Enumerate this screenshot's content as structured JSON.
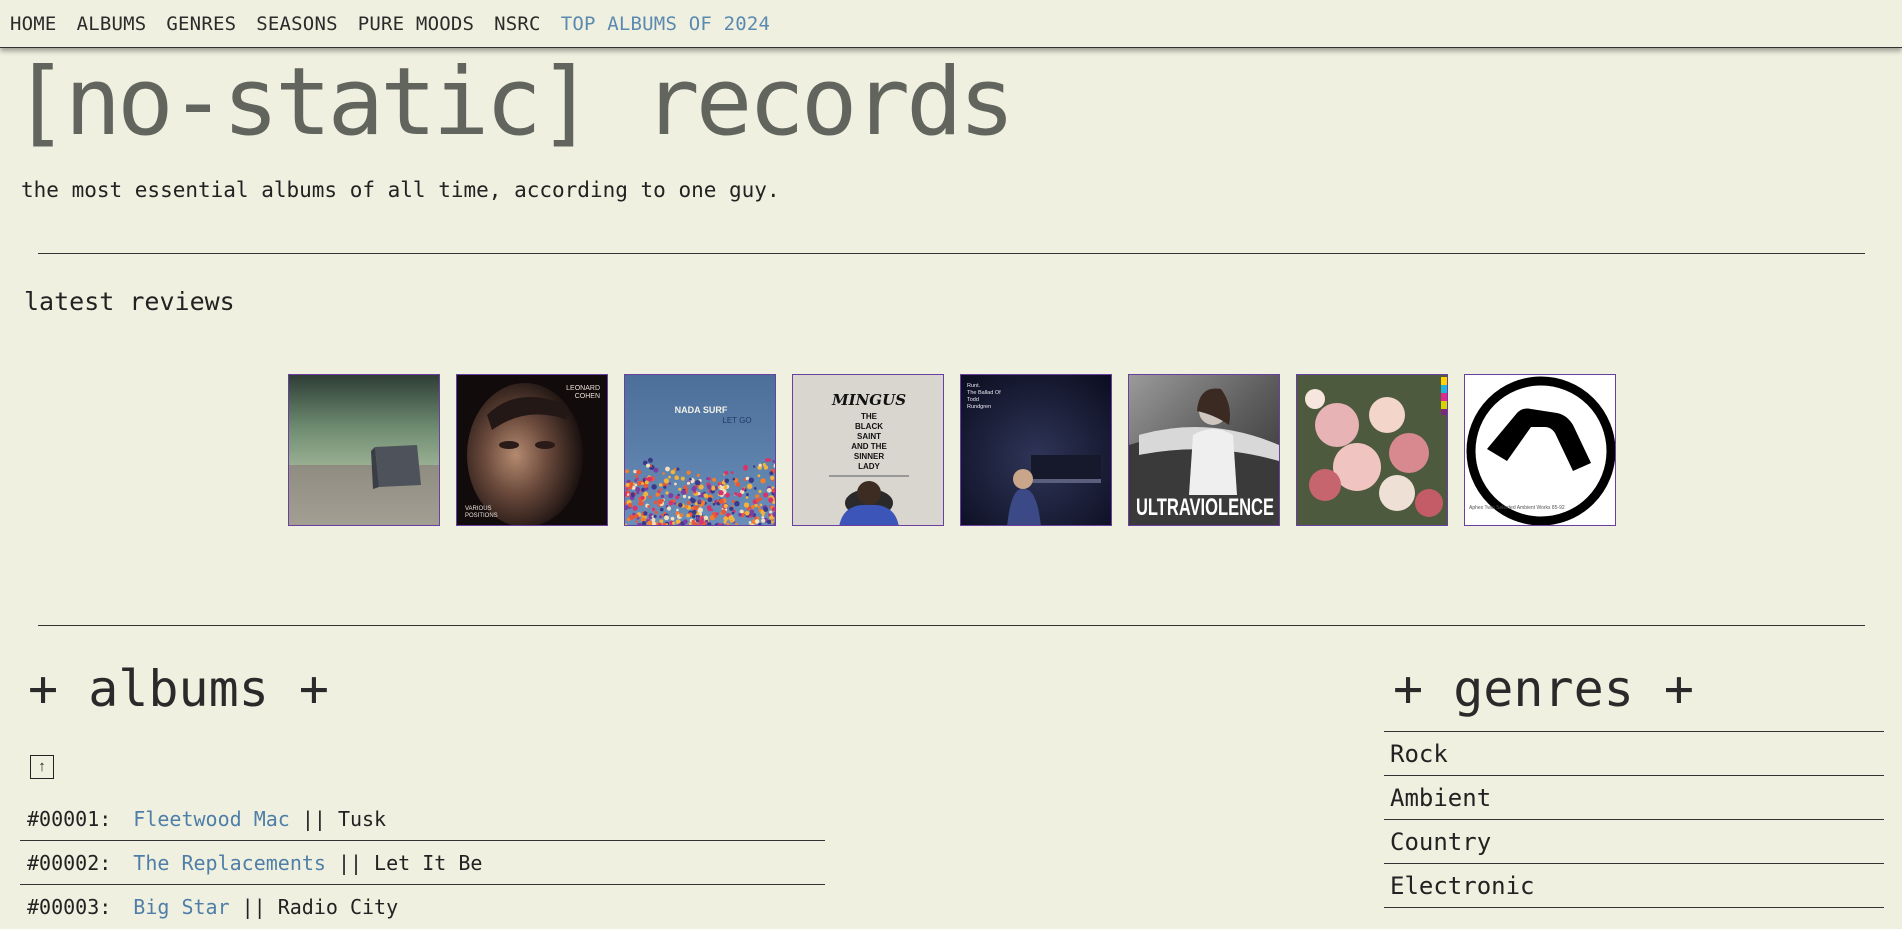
{
  "nav": {
    "items": [
      "HOME",
      "ALBUMS",
      "GENRES",
      "SEASONS",
      "PURE MOODS",
      "NSRC"
    ],
    "highlight": "TOP ALBUMS OF 2024"
  },
  "header": {
    "title": "[no-static] records",
    "tagline": "the most essential albums of all time, according to one guy."
  },
  "latest": {
    "heading": "latest reviews",
    "covers": [
      {
        "name": "album-cover-1"
      },
      {
        "name": "album-cover-leonard-cohen",
        "text1": "LEONARD",
        "text2": "COHEN",
        "text3": "VARIOUS",
        "text4": "POSITIONS"
      },
      {
        "name": "album-cover-nada-surf",
        "text1": "NADA SURF",
        "text2": "LET GO"
      },
      {
        "name": "album-cover-mingus",
        "text1": "MINGUS",
        "text2": "THE",
        "text3": "BLACK",
        "text4": "SAINT",
        "text5": "AND THE",
        "text6": "SINNER",
        "text7": "LADY"
      },
      {
        "name": "album-cover-todd-rundgren",
        "text1": "Runt.",
        "text2": "The Ballad Of",
        "text3": "Todd",
        "text4": "Rundgren"
      },
      {
        "name": "album-cover-ultraviolence",
        "text1": "ULTRAVIOLENCE"
      },
      {
        "name": "album-cover-flowers"
      },
      {
        "name": "album-cover-aphex-twin",
        "text1": "Aphex Twin Selected Ambient Works 85-92"
      }
    ]
  },
  "albums": {
    "heading": "+ albums +",
    "up_label": "↑",
    "separator": "||",
    "rows": [
      {
        "num": "#00001:",
        "artist": "Fleetwood Mac",
        "title": "Tusk"
      },
      {
        "num": "#00002:",
        "artist": "The Replacements",
        "title": "Let It Be"
      },
      {
        "num": "#00003:",
        "artist": "Big Star",
        "title": "Radio City"
      }
    ]
  },
  "genres": {
    "heading": "+ genres +",
    "items": [
      "Rock",
      "Ambient",
      "Country",
      "Electronic"
    ]
  },
  "colors": {
    "background": "#f0f0e0",
    "link": "#4f7fa8",
    "highlight": "#5a8ab0",
    "title": "#62655e",
    "cover_border": "#6a3fa0"
  }
}
